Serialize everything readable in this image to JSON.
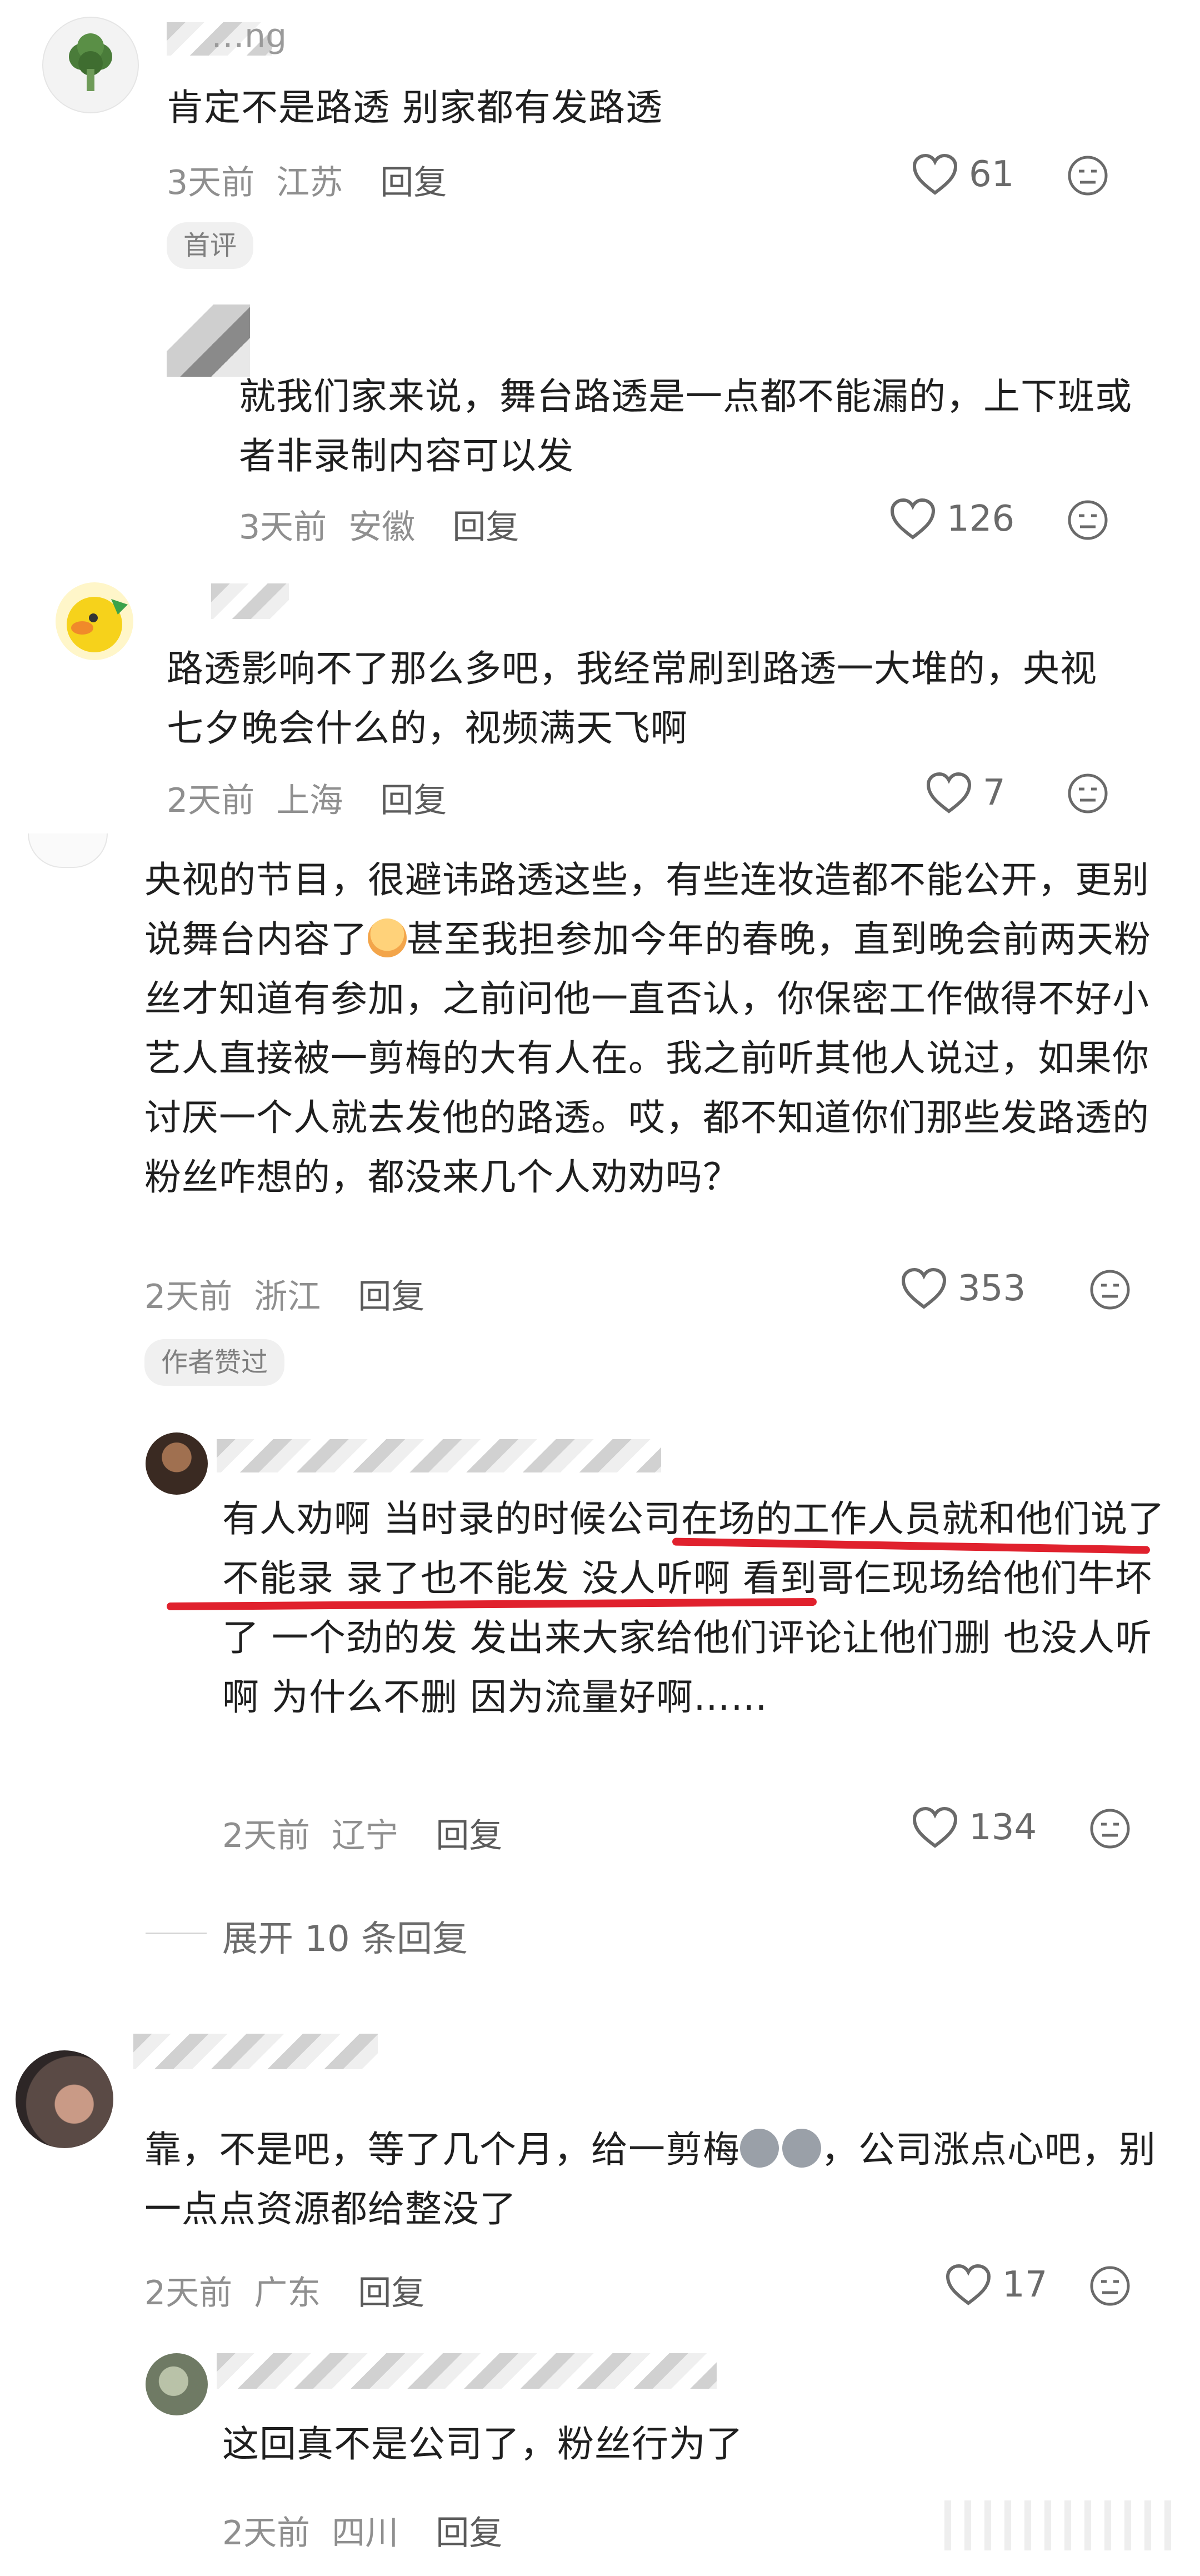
{
  "comments": [
    {
      "name": "…ng",
      "text": "肯定不是路透 别家都有发路透",
      "time": "3天前",
      "location": "江苏",
      "reply_label": "回复",
      "likes": "61",
      "badge": "首评",
      "replies": [
        {
          "text": "就我们家来说，舞台路透是一点都不能漏的，上下班或者非录制内容可以发",
          "time": "3天前",
          "location": "安徽",
          "reply_label": "回复",
          "likes": "126"
        }
      ]
    },
    {
      "text": "路透影响不了那么多吧，我经常刷到路透一大堆的，央视七夕晚会什么的，视频满天飞啊",
      "time": "2天前",
      "location": "上海",
      "reply_label": "回复",
      "likes": "7"
    },
    {
      "text_part1": "央视的节目，很避讳路透这些，有些连妆造都不能公开，更别说舞台内容了",
      "text_part2": "甚至我担参加今年的春晚，直到晚会前两天粉丝才知道有参加，之前问他一直否认，你保密工作做得不好小艺人直接被一剪梅的大有人在。我之前听其他人说过，如果你讨厌一个人就去发他的路透。哎，都不知道你们那些发路透的粉丝咋想的，都没来几个人劝劝吗？",
      "time": "2天前",
      "location": "浙江",
      "reply_label": "回复",
      "likes": "353",
      "badge": "作者赞过",
      "replies": [
        {
          "text": "有人劝啊 当时录的时候公司在场的工作人员就和他们说了不能录 录了也不能发 没人听啊 看到哥仨现场给他们牛坏了 一个劲的发 发出来大家给他们评论让他们删 也没人听啊 为什么不删 因为流量好啊……",
          "time": "2天前",
          "location": "辽宁",
          "reply_label": "回复",
          "likes": "134"
        }
      ],
      "expand_label": "展开 10 条回复"
    },
    {
      "text_part1": "靠，不是吧，等了几个月，给一剪梅",
      "text_part2": "，公司涨点心吧，别一点点资源都给整没了",
      "time": "2天前",
      "location": "广东",
      "reply_label": "回复",
      "likes": "17",
      "replies": [
        {
          "text": "这回真不是公司了，粉丝行为了",
          "time": "2天前",
          "location": "四川",
          "reply_label": "回复"
        }
      ]
    }
  ],
  "icons": {
    "heart": "heart-outline-icon",
    "dislike": "dislike-face-icon",
    "avatar_1": "broccoli-avatar",
    "avatar_2": "yellow-duck-avatar"
  },
  "colors": {
    "underline": "#e0212d",
    "meta": "#8f8f8f",
    "badge_bg": "#f0f0f0"
  }
}
